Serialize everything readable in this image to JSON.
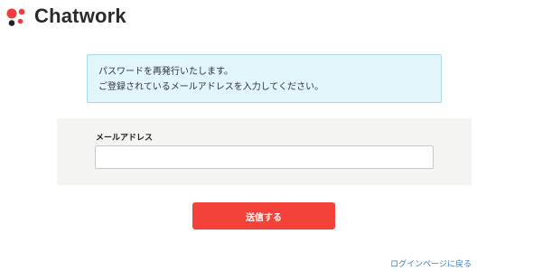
{
  "header": {
    "brand_name": "Chatwork",
    "logo_icon": "chatwork-logo-icon",
    "brand_colors": [
      "#f03c3c",
      "#222222"
    ]
  },
  "notice": {
    "line1": "パスワードを再発行いたします。",
    "line2": "ご登録されているメールアドレスを入力してください。",
    "background_color": "#e1f5fa",
    "border_color": "#a7dbea"
  },
  "form": {
    "email_label": "メールアドレス",
    "email_value": "",
    "email_placeholder": ""
  },
  "submit": {
    "label": "送信する",
    "color": "#f4423a"
  },
  "footer": {
    "back_to_login": "ログインページに戻る",
    "link_color": "#3f7ec7"
  }
}
